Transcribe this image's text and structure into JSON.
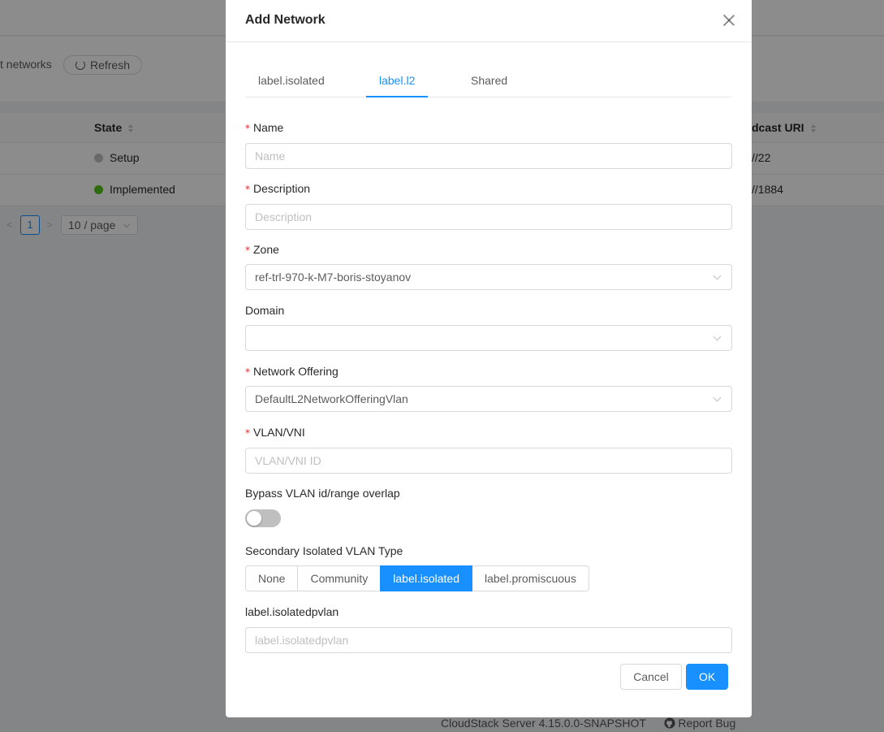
{
  "background": {
    "networks_text": "t networks",
    "refresh_label": "Refresh",
    "table": {
      "headers": {
        "state": "State",
        "broadcast_uri": "dcast URI"
      },
      "rows": [
        {
          "state": "Setup",
          "state_color": "#bfbfbf",
          "broadcast_uri": "//22"
        },
        {
          "state": "Implemented",
          "state_color": "#52c41a",
          "broadcast_uri": "//1884"
        }
      ]
    },
    "pagination": {
      "prev": "<",
      "current": "1",
      "next": ">",
      "page_size": "10 / page"
    },
    "footer": {
      "version": "CloudStack Server 4.15.0.0-SNAPSHOT",
      "report_bug": "Report Bug"
    }
  },
  "modal": {
    "title": "Add Network",
    "tabs": [
      {
        "label": "label.isolated",
        "active": false
      },
      {
        "label": "label.l2",
        "active": true
      },
      {
        "label": "Shared",
        "active": false
      }
    ],
    "required_mark": "*",
    "fields": {
      "name": {
        "label": "Name",
        "placeholder": "Name",
        "value": ""
      },
      "description": {
        "label": "Description",
        "placeholder": "Description",
        "value": ""
      },
      "zone": {
        "label": "Zone",
        "value": "ref-trl-970-k-M7-boris-stoyanov"
      },
      "domain": {
        "label": "Domain",
        "value": ""
      },
      "network_offering": {
        "label": "Network Offering",
        "value": "DefaultL2NetworkOfferingVlan"
      },
      "vlan": {
        "label": "VLAN/VNI",
        "placeholder": "VLAN/VNI ID",
        "value": ""
      },
      "bypass": {
        "label": "Bypass VLAN id/range overlap",
        "checked": false
      },
      "secondary_vlan_type": {
        "label": "Secondary Isolated VLAN Type",
        "options": [
          "None",
          "Community",
          "label.isolated",
          "label.promiscuous"
        ],
        "selected": "label.isolated"
      },
      "isolated_pvlan": {
        "label": "label.isolatedpvlan",
        "placeholder": "label.isolatedpvlan",
        "value": ""
      }
    },
    "buttons": {
      "cancel": "Cancel",
      "ok": "OK"
    },
    "colors": {
      "primary": "#1890ff",
      "required": "#f5222d",
      "switch_off": "#bfbfbf"
    }
  }
}
